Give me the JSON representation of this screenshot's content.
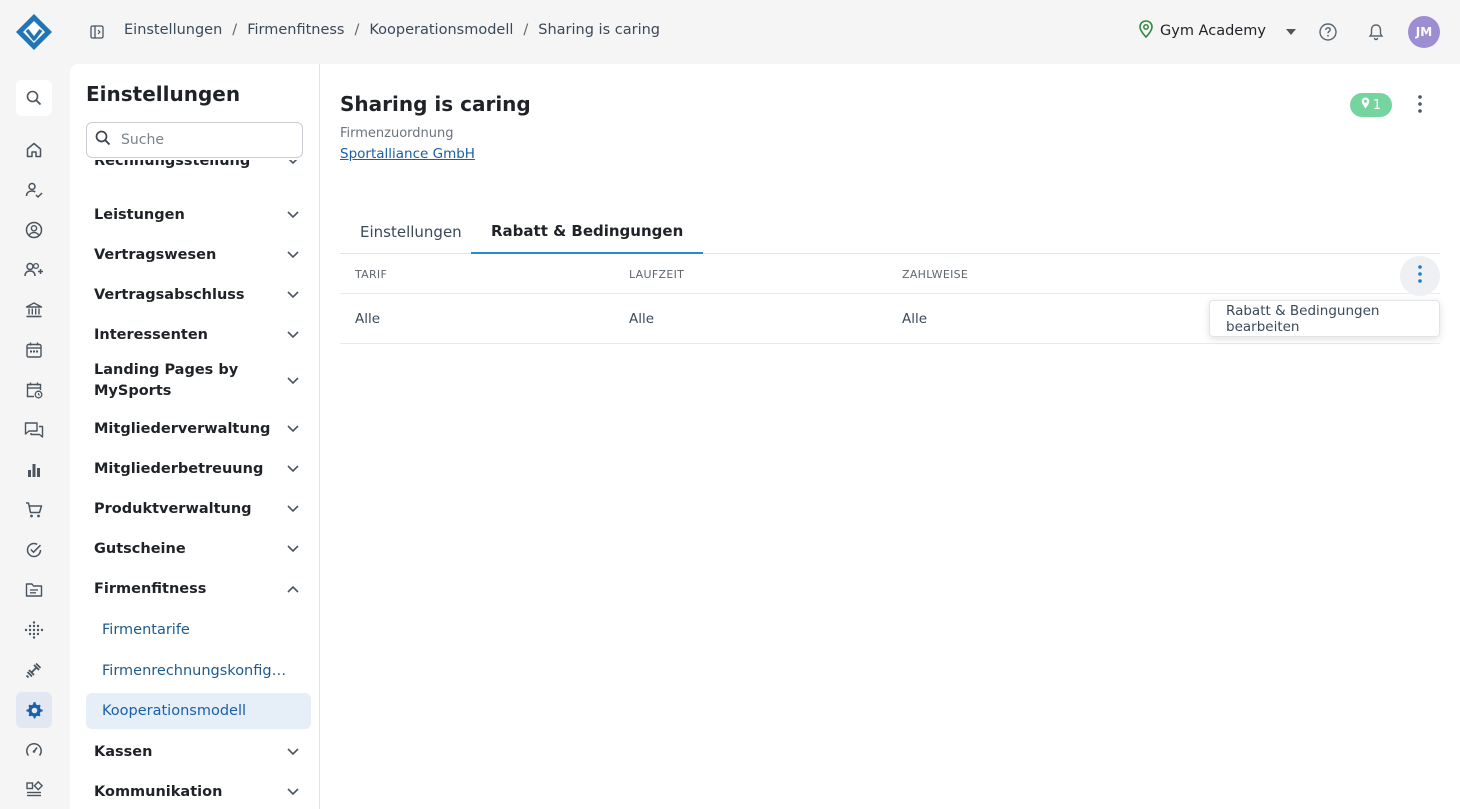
{
  "breadcrumb": [
    "Einstellungen",
    "Firmenfitness",
    "Kooperationsmodell",
    "Sharing is caring"
  ],
  "org": {
    "name": "Gym Academy"
  },
  "user": {
    "initials": "JM"
  },
  "rail": [
    "search-icon",
    "home-icon",
    "user-check-icon",
    "user-circle-icon",
    "user-plus-icon",
    "bank-icon",
    "calendar-icon",
    "calendar-clock-icon",
    "chat-icon",
    "bar-chart-icon",
    "cart-icon",
    "check-circle-icon",
    "folder-icon",
    "grid-dots-icon",
    "dumbbell-icon",
    "gear-icon",
    "speedometer-icon",
    "widgets-icon"
  ],
  "sidebar": {
    "title": "Einstellungen",
    "search_placeholder": "Suche",
    "items": [
      {
        "label": "Rechnungsstellung"
      },
      {
        "label": "Leistungen"
      },
      {
        "label": "Vertragswesen"
      },
      {
        "label": "Vertragsabschluss"
      },
      {
        "label": "Interessenten"
      },
      {
        "label": "Landing Pages by MySports"
      },
      {
        "label": "Mitgliederverwaltung"
      },
      {
        "label": "Mitgliederbetreuung"
      },
      {
        "label": "Produktverwaltung"
      },
      {
        "label": "Gutscheine"
      },
      {
        "label": "Firmenfitness"
      },
      {
        "label": "Kassen"
      },
      {
        "label": "Kommunikation"
      }
    ],
    "sub_items": [
      {
        "label": "Firmentarife"
      },
      {
        "label": "Firmenrechnungskonfigurationen"
      },
      {
        "label": "Kooperationsmodell"
      }
    ]
  },
  "main": {
    "title": "Sharing is caring",
    "company_label": "Firmenzuordnung",
    "company_link": "Sportalliance GmbH",
    "badge_count": "1",
    "tabs": [
      "Einstellungen",
      "Rabatt & Bedingungen"
    ],
    "table": {
      "headers": [
        "TARIF",
        "LAUFZEIT",
        "ZAHLWEISE"
      ],
      "rows": [
        [
          "Alle",
          "Alle",
          "Alle"
        ]
      ]
    },
    "menu_item": "Rabatt & Bedingungen bearbeiten"
  },
  "colors": {
    "accent": "#1a5fa8",
    "tab_underline": "#2b8ac9",
    "badge": "#76d49e",
    "avatar": "#9b8ed2"
  }
}
